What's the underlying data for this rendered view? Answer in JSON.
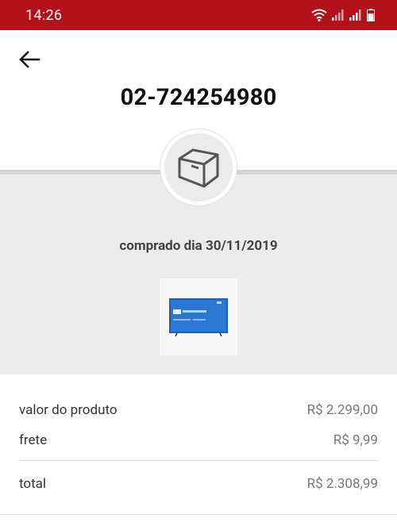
{
  "status_bar": {
    "time": "14:26",
    "icons": [
      "wifi-icon",
      "signal-icon",
      "signal-icon",
      "battery-icon"
    ]
  },
  "header": {
    "back_icon": "arrow-left-icon",
    "order_number": "02-724254980"
  },
  "order": {
    "status_icon": "package-box-icon",
    "purchase_date": "comprado dia 30/11/2019",
    "product_image": "tv-product-image"
  },
  "summary": {
    "product_label": "valor do produto",
    "product_value": "R$ 2.299,00",
    "shipping_label": "frete",
    "shipping_value": "R$ 9,99",
    "total_label": "total",
    "total_value": "R$ 2.308,99"
  },
  "colors": {
    "status_bar": "#b3121a",
    "gray_section": "#ebebeb"
  }
}
